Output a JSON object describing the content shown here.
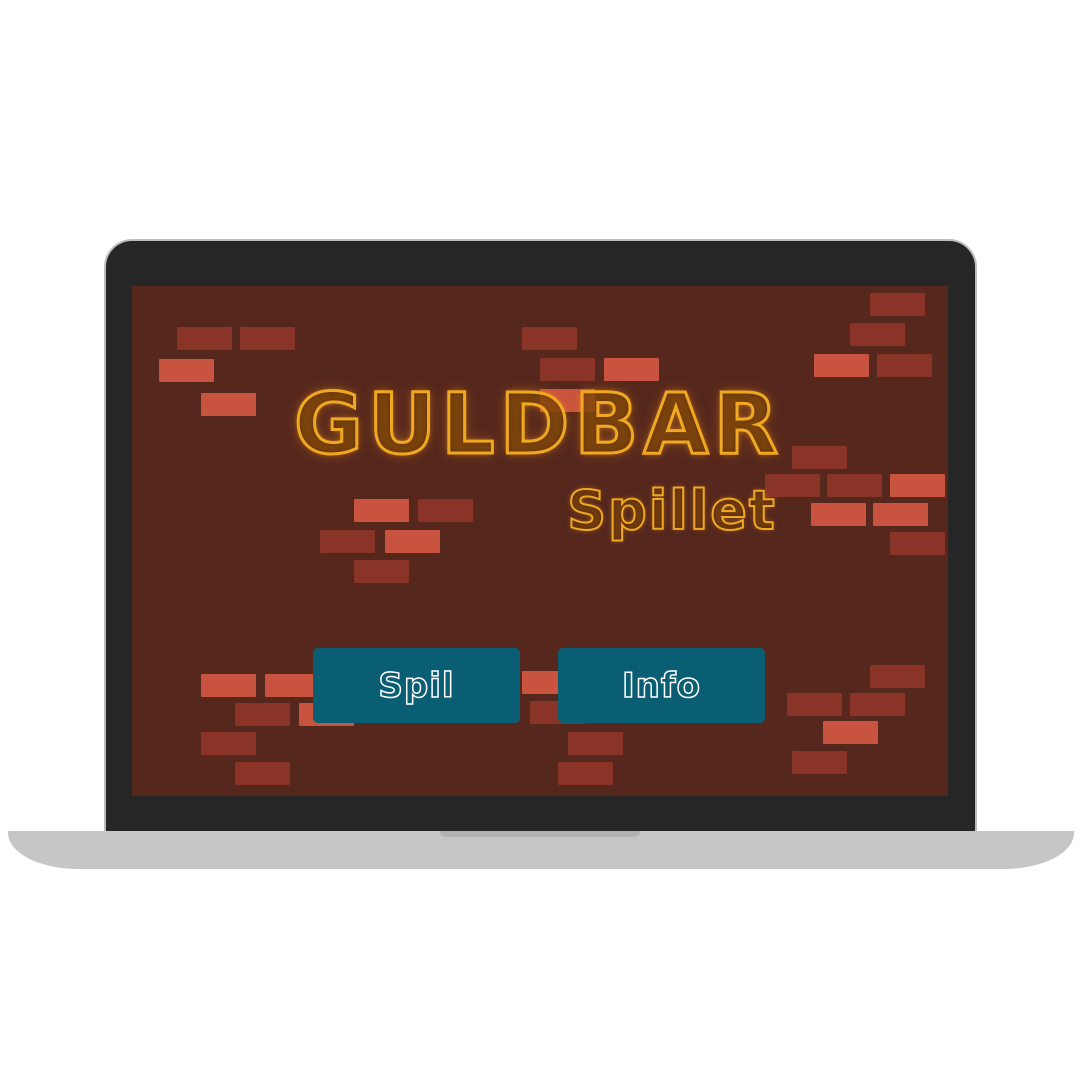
{
  "game": {
    "title": "GULDBAR",
    "subtitle": "Spillet"
  },
  "menu": {
    "play_label": "Spil",
    "info_label": "Info"
  },
  "colors": {
    "wall": "#55271d",
    "brick_dark": "#8a3428",
    "brick_light": "#c8533f",
    "neon": "#f0a820",
    "button": "#0a5e73",
    "bezel": "#262626",
    "base": "#c6c6c6"
  }
}
